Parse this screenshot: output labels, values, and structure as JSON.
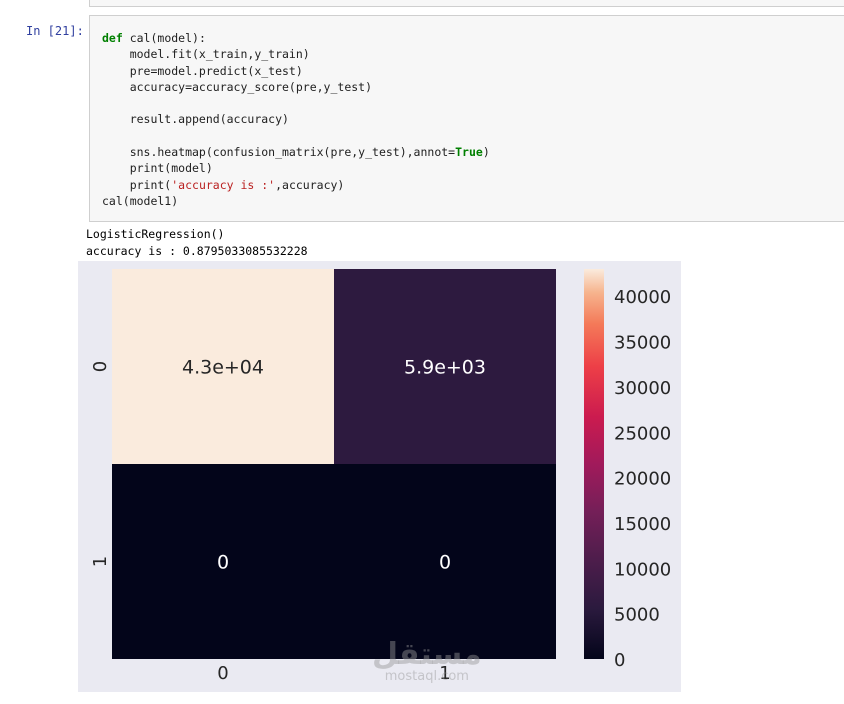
{
  "cell": {
    "prompt": "In [21]:",
    "code": [
      [
        {
          "t": "def",
          "c": "kw"
        },
        {
          "t": " cal(model):"
        }
      ],
      [
        {
          "t": "    model.fit(x_train,y_train)"
        }
      ],
      [
        {
          "t": "    pre=model.predict(x_test)"
        }
      ],
      [
        {
          "t": "    accuracy=accuracy_score(pre,y_test)"
        }
      ],
      [
        {
          "t": ""
        }
      ],
      [
        {
          "t": "    result.append(accuracy)"
        }
      ],
      [
        {
          "t": ""
        }
      ],
      [
        {
          "t": "    sns.heatmap(confusion_matrix(pre,y_test),annot="
        },
        {
          "t": "True",
          "c": "kw"
        },
        {
          "t": ")"
        }
      ],
      [
        {
          "t": "    print(model)"
        }
      ],
      [
        {
          "t": "    print("
        },
        {
          "t": "'accuracy is :'",
          "c": "str"
        },
        {
          "t": ",accuracy)"
        }
      ],
      [
        {
          "t": "cal(model1)"
        }
      ]
    ]
  },
  "output": {
    "line1": "LogisticRegression()",
    "line2": "accuracy is : 0.8795033085532228"
  },
  "chart_data": {
    "type": "heatmap",
    "x_labels": [
      "0",
      "1"
    ],
    "y_labels": [
      "0",
      "1"
    ],
    "values": [
      [
        43000,
        5900
      ],
      [
        0,
        0
      ]
    ],
    "annotations": [
      [
        "4.3e+04",
        "5.9e+03"
      ],
      [
        "0",
        "0"
      ]
    ],
    "colormap": "rocket",
    "colorbar": {
      "ticks": [
        0,
        5000,
        10000,
        15000,
        20000,
        25000,
        30000,
        35000,
        40000
      ],
      "range": [
        0,
        43000
      ]
    }
  },
  "watermark": {
    "arabic": "مستقل",
    "latin": "mostaql.com"
  }
}
